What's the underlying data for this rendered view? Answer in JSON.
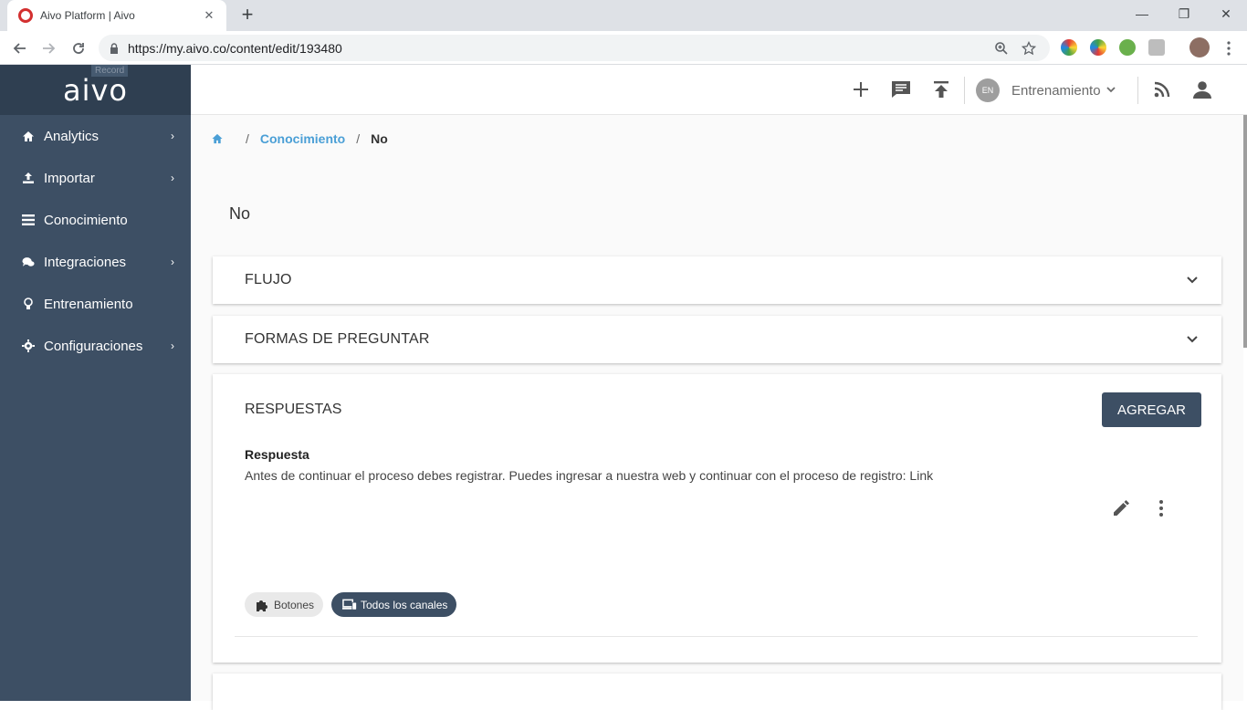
{
  "browser": {
    "tab_title": "Aivo Platform | Aivo",
    "url": "https://my.aivo.co/content/edit/193480",
    "close_tab": "✕",
    "new_tab": "+",
    "minimize": "—",
    "maximize": "❐",
    "close_window": "✕"
  },
  "sidebar": {
    "brand": "aivo",
    "record_label": "Record",
    "items": [
      {
        "label": "Analytics",
        "icon": "home-icon",
        "has_children": true
      },
      {
        "label": "Importar",
        "icon": "upload-icon",
        "has_children": true
      },
      {
        "label": "Conocimiento",
        "icon": "list-icon",
        "has_children": false
      },
      {
        "label": "Integraciones",
        "icon": "chat-icon",
        "has_children": true
      },
      {
        "label": "Entrenamiento",
        "icon": "lightbulb-icon",
        "has_children": false
      },
      {
        "label": "Configuraciones",
        "icon": "gear-icon",
        "has_children": true
      }
    ],
    "chevron": "›"
  },
  "appbar": {
    "lang_badge": "EN",
    "environment": "Entrenamiento",
    "env_chevron": "⌄"
  },
  "breadcrumb": {
    "sep": "/",
    "link": "Conocimiento",
    "current": "No"
  },
  "page": {
    "title": "No"
  },
  "sections": {
    "flow": "FLUJO",
    "questions": "FORMAS DE PREGUNTAR",
    "answers": "RESPUESTAS"
  },
  "answers": {
    "add_label": "AGREGAR",
    "items": [
      {
        "title": "Respuesta",
        "text": "Antes de continuar el proceso debes registrar. Puedes ingresar a nuestra web y continuar con el proceso de registro: Link",
        "chips": [
          "Botones",
          "Todos los canales"
        ]
      }
    ]
  },
  "colors": {
    "sidebar": "#3d4f64",
    "brand_bg": "#2f3f51",
    "link": "#4a9fd6",
    "button": "#3d4f64"
  }
}
